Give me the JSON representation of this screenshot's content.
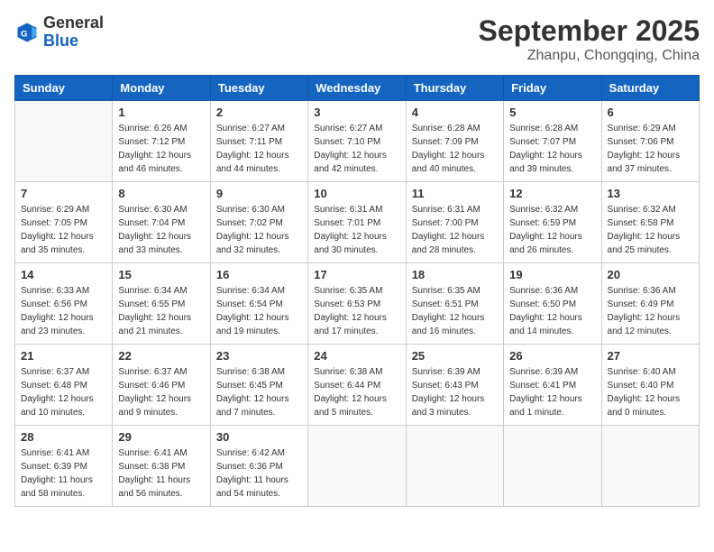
{
  "header": {
    "logo_general": "General",
    "logo_blue": "Blue",
    "month_title": "September 2025",
    "location": "Zhanpu, Chongqing, China"
  },
  "weekdays": [
    "Sunday",
    "Monday",
    "Tuesday",
    "Wednesday",
    "Thursday",
    "Friday",
    "Saturday"
  ],
  "weeks": [
    [
      {
        "day": "",
        "info": ""
      },
      {
        "day": "1",
        "info": "Sunrise: 6:26 AM\nSunset: 7:12 PM\nDaylight: 12 hours\nand 46 minutes."
      },
      {
        "day": "2",
        "info": "Sunrise: 6:27 AM\nSunset: 7:11 PM\nDaylight: 12 hours\nand 44 minutes."
      },
      {
        "day": "3",
        "info": "Sunrise: 6:27 AM\nSunset: 7:10 PM\nDaylight: 12 hours\nand 42 minutes."
      },
      {
        "day": "4",
        "info": "Sunrise: 6:28 AM\nSunset: 7:09 PM\nDaylight: 12 hours\nand 40 minutes."
      },
      {
        "day": "5",
        "info": "Sunrise: 6:28 AM\nSunset: 7:07 PM\nDaylight: 12 hours\nand 39 minutes."
      },
      {
        "day": "6",
        "info": "Sunrise: 6:29 AM\nSunset: 7:06 PM\nDaylight: 12 hours\nand 37 minutes."
      }
    ],
    [
      {
        "day": "7",
        "info": "Sunrise: 6:29 AM\nSunset: 7:05 PM\nDaylight: 12 hours\nand 35 minutes."
      },
      {
        "day": "8",
        "info": "Sunrise: 6:30 AM\nSunset: 7:04 PM\nDaylight: 12 hours\nand 33 minutes."
      },
      {
        "day": "9",
        "info": "Sunrise: 6:30 AM\nSunset: 7:02 PM\nDaylight: 12 hours\nand 32 minutes."
      },
      {
        "day": "10",
        "info": "Sunrise: 6:31 AM\nSunset: 7:01 PM\nDaylight: 12 hours\nand 30 minutes."
      },
      {
        "day": "11",
        "info": "Sunrise: 6:31 AM\nSunset: 7:00 PM\nDaylight: 12 hours\nand 28 minutes."
      },
      {
        "day": "12",
        "info": "Sunrise: 6:32 AM\nSunset: 6:59 PM\nDaylight: 12 hours\nand 26 minutes."
      },
      {
        "day": "13",
        "info": "Sunrise: 6:32 AM\nSunset: 6:58 PM\nDaylight: 12 hours\nand 25 minutes."
      }
    ],
    [
      {
        "day": "14",
        "info": "Sunrise: 6:33 AM\nSunset: 6:56 PM\nDaylight: 12 hours\nand 23 minutes."
      },
      {
        "day": "15",
        "info": "Sunrise: 6:34 AM\nSunset: 6:55 PM\nDaylight: 12 hours\nand 21 minutes."
      },
      {
        "day": "16",
        "info": "Sunrise: 6:34 AM\nSunset: 6:54 PM\nDaylight: 12 hours\nand 19 minutes."
      },
      {
        "day": "17",
        "info": "Sunrise: 6:35 AM\nSunset: 6:53 PM\nDaylight: 12 hours\nand 17 minutes."
      },
      {
        "day": "18",
        "info": "Sunrise: 6:35 AM\nSunset: 6:51 PM\nDaylight: 12 hours\nand 16 minutes."
      },
      {
        "day": "19",
        "info": "Sunrise: 6:36 AM\nSunset: 6:50 PM\nDaylight: 12 hours\nand 14 minutes."
      },
      {
        "day": "20",
        "info": "Sunrise: 6:36 AM\nSunset: 6:49 PM\nDaylight: 12 hours\nand 12 minutes."
      }
    ],
    [
      {
        "day": "21",
        "info": "Sunrise: 6:37 AM\nSunset: 6:48 PM\nDaylight: 12 hours\nand 10 minutes."
      },
      {
        "day": "22",
        "info": "Sunrise: 6:37 AM\nSunset: 6:46 PM\nDaylight: 12 hours\nand 9 minutes."
      },
      {
        "day": "23",
        "info": "Sunrise: 6:38 AM\nSunset: 6:45 PM\nDaylight: 12 hours\nand 7 minutes."
      },
      {
        "day": "24",
        "info": "Sunrise: 6:38 AM\nSunset: 6:44 PM\nDaylight: 12 hours\nand 5 minutes."
      },
      {
        "day": "25",
        "info": "Sunrise: 6:39 AM\nSunset: 6:43 PM\nDaylight: 12 hours\nand 3 minutes."
      },
      {
        "day": "26",
        "info": "Sunrise: 6:39 AM\nSunset: 6:41 PM\nDaylight: 12 hours\nand 1 minute."
      },
      {
        "day": "27",
        "info": "Sunrise: 6:40 AM\nSunset: 6:40 PM\nDaylight: 12 hours\nand 0 minutes."
      }
    ],
    [
      {
        "day": "28",
        "info": "Sunrise: 6:41 AM\nSunset: 6:39 PM\nDaylight: 11 hours\nand 58 minutes."
      },
      {
        "day": "29",
        "info": "Sunrise: 6:41 AM\nSunset: 6:38 PM\nDaylight: 11 hours\nand 56 minutes."
      },
      {
        "day": "30",
        "info": "Sunrise: 6:42 AM\nSunset: 6:36 PM\nDaylight: 11 hours\nand 54 minutes."
      },
      {
        "day": "",
        "info": ""
      },
      {
        "day": "",
        "info": ""
      },
      {
        "day": "",
        "info": ""
      },
      {
        "day": "",
        "info": ""
      }
    ]
  ]
}
